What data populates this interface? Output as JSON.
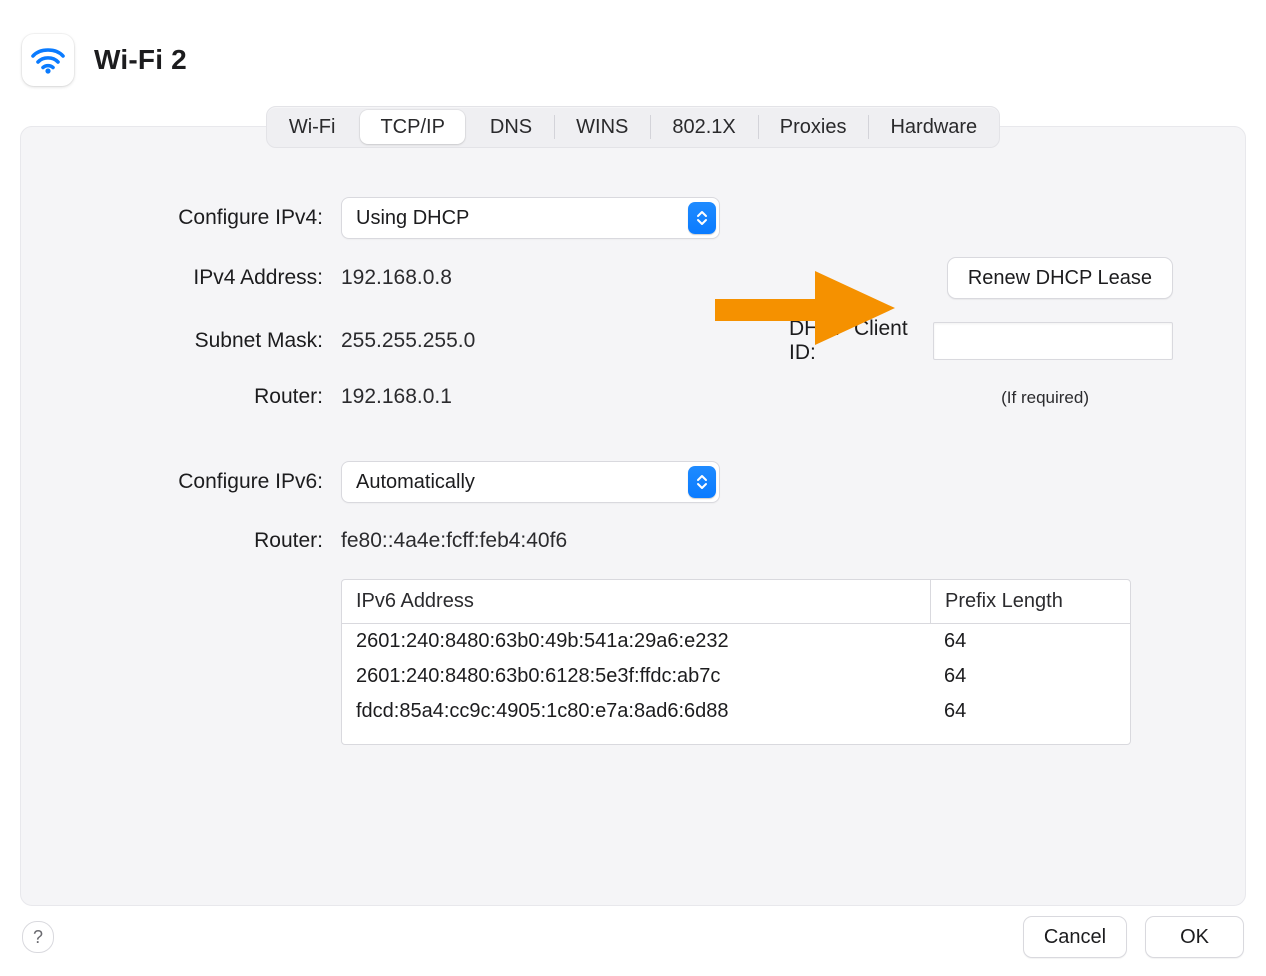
{
  "header": {
    "title": "Wi-Fi 2"
  },
  "tabs": {
    "items": [
      "Wi-Fi",
      "TCP/IP",
      "DNS",
      "WINS",
      "802.1X",
      "Proxies",
      "Hardware"
    ],
    "active_index": 1
  },
  "ipv4": {
    "configure_label": "Configure IPv4:",
    "configure_value": "Using DHCP",
    "address_label": "IPv4 Address:",
    "address_value": "192.168.0.8",
    "subnet_label": "Subnet Mask:",
    "subnet_value": "255.255.255.0",
    "router_label": "Router:",
    "router_value": "192.168.0.1"
  },
  "dhcp": {
    "renew_button": "Renew DHCP Lease",
    "client_id_label": "DHCP Client ID:",
    "client_id_value": "",
    "hint": "(If required)"
  },
  "ipv6": {
    "configure_label": "Configure IPv6:",
    "configure_value": "Automatically",
    "router_label": "Router:",
    "router_value": "fe80::4a4e:fcff:feb4:40f6",
    "table": {
      "columns": [
        "IPv6 Address",
        "Prefix Length"
      ],
      "rows": [
        {
          "address": "2601:240:8480:63b0:49b:541a:29a6:e232",
          "prefix": "64"
        },
        {
          "address": "2601:240:8480:63b0:6128:5e3f:ffdc:ab7c",
          "prefix": "64"
        },
        {
          "address": "fdcd:85a4:cc9c:4905:1c80:e7a:8ad6:6d88",
          "prefix": "64"
        }
      ]
    }
  },
  "footer": {
    "help": "?",
    "cancel": "Cancel",
    "ok": "OK"
  },
  "annotation": {
    "arrow_color": "#f59100"
  }
}
